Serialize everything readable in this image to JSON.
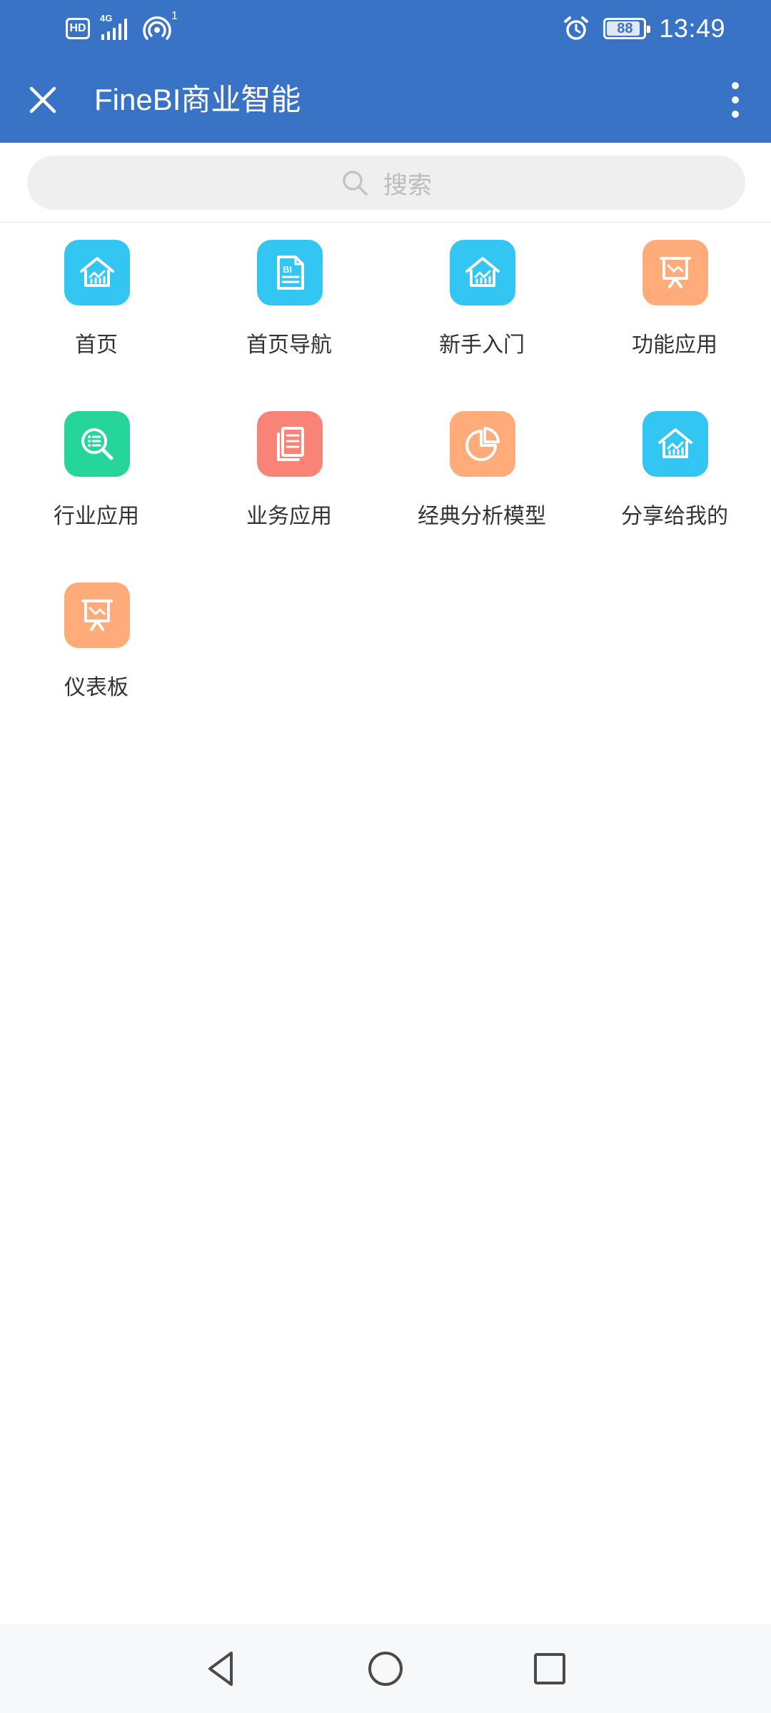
{
  "status_bar": {
    "hd_label": "HD",
    "network_label": "4G",
    "hotspot_count": "1",
    "battery_level": "88",
    "time": "13:49"
  },
  "app_bar": {
    "title": "FineBI商业智能",
    "close_icon": "close-icon",
    "more_icon": "more-vertical-icon"
  },
  "search": {
    "placeholder": "搜索",
    "icon": "search-icon"
  },
  "colors": {
    "primary": "#3973C6",
    "cyan": "#33C6F2",
    "orange": "#FFAB7A",
    "green": "#25D59A",
    "red": "#F98377"
  },
  "grid": [
    {
      "label": "首页",
      "icon": "home-chart-icon",
      "color": "#33C6F2"
    },
    {
      "label": "首页导航",
      "icon": "bi-document-icon",
      "color": "#33C6F2"
    },
    {
      "label": "新手入门",
      "icon": "home-chart-icon",
      "color": "#33C6F2"
    },
    {
      "label": "功能应用",
      "icon": "presentation-board-icon",
      "color": "#FFAB7A"
    },
    {
      "label": "行业应用",
      "icon": "magnifier-list-icon",
      "color": "#25D59A"
    },
    {
      "label": "业务应用",
      "icon": "documents-icon",
      "color": "#F98377"
    },
    {
      "label": "经典分析模型",
      "icon": "pie-chart-icon",
      "color": "#FFAB7A"
    },
    {
      "label": "分享给我的",
      "icon": "home-chart-icon",
      "color": "#33C6F2"
    },
    {
      "label": "仪表板",
      "icon": "presentation-board-icon",
      "color": "#FFAB7A"
    }
  ],
  "nav_bar": {
    "back_icon": "back-triangle-icon",
    "home_icon": "home-circle-icon",
    "recents_icon": "recents-square-icon"
  }
}
